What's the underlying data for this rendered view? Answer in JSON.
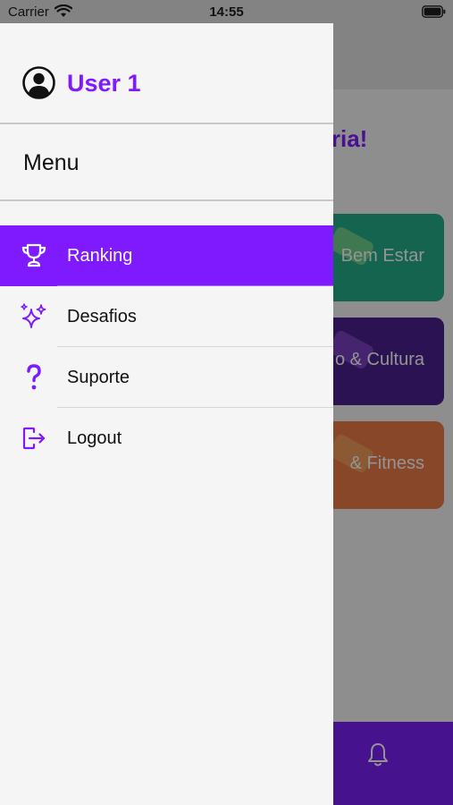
{
  "status_bar": {
    "carrier": "Carrier",
    "time": "14:55"
  },
  "background": {
    "heading_partial": "oria!",
    "cards": [
      {
        "label": "Bem Estar",
        "color": "#25ad8b"
      },
      {
        "label": "o & Cultura",
        "color": "#4a1f8f"
      },
      {
        "label": "& Fitness",
        "color": "#e97b45"
      }
    ],
    "nav_color": "#7a1ff5"
  },
  "drawer": {
    "user_name": "User 1",
    "avatar_icon": "user-circle-icon",
    "section_title": "Menu",
    "items": [
      {
        "label": "Ranking",
        "icon": "trophy-icon",
        "active": true
      },
      {
        "label": "Desafios",
        "icon": "sparkles-icon",
        "active": false
      },
      {
        "label": "Suporte",
        "icon": "question-mark-icon",
        "active": false
      },
      {
        "label": "Logout",
        "icon": "logout-icon",
        "active": false
      }
    ]
  },
  "colors": {
    "accent": "#7f1aff",
    "drawer_bg": "#f5f5f5"
  }
}
